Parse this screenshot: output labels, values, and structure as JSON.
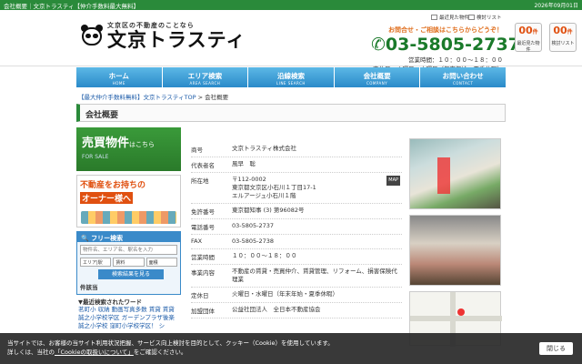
{
  "topbar": {
    "left": "会社概要｜文京トラスティ【仲介手数料最大無料】",
    "date": "2026年09月01日"
  },
  "logo": {
    "sub": "文京区の不動産のことなら",
    "main": "文京トラスティ"
  },
  "contact": {
    "lead": "お問合せ・ご相談はこちらからどうぞ！",
    "phone": "03-5805-2737",
    "hours": "営業時間：１０：００～１８：００",
    "closed": "定休日：火曜日・水曜日（年末年始・夏季休暇）"
  },
  "util": {
    "recent": "最近見た物件",
    "watch": "検討リスト"
  },
  "history": [
    {
      "num": "00",
      "unit": "件",
      "label": "最近見た物件"
    },
    {
      "num": "00",
      "unit": "件",
      "label": "検討リスト"
    }
  ],
  "nav": [
    {
      "jp": "ホーム",
      "en": "HOME"
    },
    {
      "jp": "エリア検索",
      "en": "AREA SEARCH"
    },
    {
      "jp": "沿線検索",
      "en": "LINE SEARCH"
    },
    {
      "jp": "会社概要",
      "en": "COMPANY"
    },
    {
      "jp": "お問い合わせ",
      "en": "CONTACT"
    }
  ],
  "breadcrumb": {
    "home": "【最大仲介手数料無料】文京トラスティTOP",
    "sep": ">",
    "current": "会社概要"
  },
  "page_title": "会社概要",
  "sidebar": {
    "banner1": {
      "big": "売買物件",
      "small_jp": "はこちら",
      "en": "FOR SALE"
    },
    "banner2": {
      "line1": "不動産をお持ちの",
      "line2": "オーナー様へ"
    },
    "search": {
      "title": "フリー検索",
      "placeholder": "物件名、エリア名、駅名を入力",
      "select1": "エリア|駅",
      "select2": "賃料",
      "select3": "面積",
      "button": "検索結果を見る",
      "cond": "件該当",
      "recent_head": "最近検索されたワード",
      "recent_text": "茗町小 収納 動画写真多数 賃貸 賃貸 誠之小学校学区 ガーデンプラザ後楽 誠之小学校 窪町小学校学区！ シ"
    }
  },
  "company": [
    {
      "k": "商号",
      "v": "文京トラスティ株式会社"
    },
    {
      "k": "代表者名",
      "v": "風早　聡"
    },
    {
      "k": "所在地",
      "v": "〒112-0002\n東京都文京区小石川１丁目17-1\nエルアージュ小石川１階",
      "map": "MAP"
    },
    {
      "k": "免許番号",
      "v": "東京都知事 (3) 第96082号"
    },
    {
      "k": "電話番号",
      "v": "03-5805-2737"
    },
    {
      "k": "FAX",
      "v": "03-5805-2738"
    },
    {
      "k": "営業時間",
      "v": "１０：００～１８：００"
    },
    {
      "k": "事業内容",
      "v": "不動産の賃貸・売買仲介、賃貸管理、リフォーム、損害保険代理業"
    },
    {
      "k": "定休日",
      "v": "火曜日・水曜日（年末年始・夏季休暇）"
    },
    {
      "k": "加盟団体",
      "v": "公益社団法人　全日本不動産協会"
    }
  ],
  "cookie": {
    "line1": "当サイトでは、お客様の当サイト利用状況把握、サービス向上検討を目的として、クッキー（Cookie）を使用しています。",
    "line2_pre": "詳しくは、当社の",
    "link": "「Cookieの取扱いについて」",
    "line2_post": "をご確認ください。",
    "close": "閉じる"
  }
}
